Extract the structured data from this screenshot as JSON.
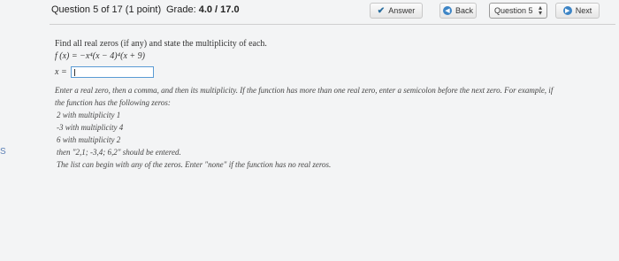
{
  "header": {
    "question": "Question 5 of 17 (1 point)",
    "grade_label": "Grade:",
    "grade_value": "4.0 / 17.0",
    "answer_label": "Answer",
    "back_label": "Back",
    "question_select": "Question 5",
    "next_label": "Next"
  },
  "side_text": "S",
  "question": {
    "prompt": "Find all real zeros (if any) and state the multiplicity of each.",
    "function": "f (x)  =  −x⁴(x − 4)⁴(x + 9)",
    "answer_label": "x =",
    "answer_value": ""
  },
  "instructions": {
    "line1": "Enter a real zero, then a comma, and then its multiplicity. If the function has more than one real zero, enter a semicolon before the next zero. For example, if",
    "line2": "the function has the following zeros:",
    "ex1": "2 with multiplicity 1",
    "ex2": "-3 with multiplicity 4",
    "ex3": "6 with multiplicity 2",
    "then": "then \"2,1; -3,4; 6,2\" should be entered.",
    "last": "The list can begin with any of the zeros. Enter \"none\" if the function has no real zeros."
  },
  "colors": {
    "accent": "#3d85c6",
    "input_border": "#5a9bd4",
    "background": "#f3f4f5"
  },
  "icons": [
    "check-icon",
    "back-arrow-icon",
    "updown-icon",
    "next-arrow-icon"
  ]
}
